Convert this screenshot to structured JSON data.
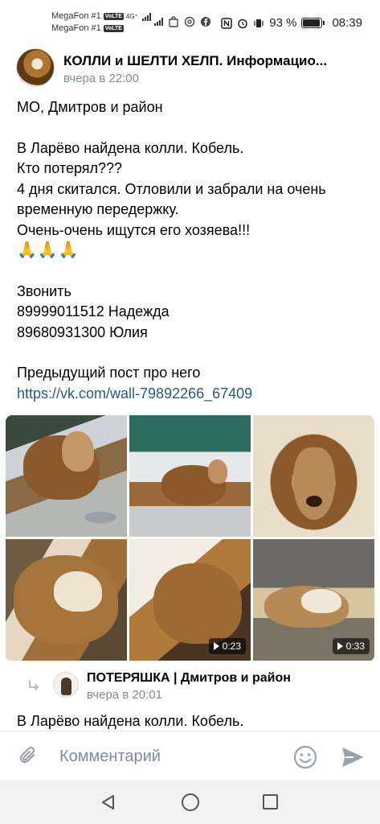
{
  "status_bar": {
    "carrier1": "MegaFon #1",
    "carrier2": "MegaFon #1",
    "volte": "VoLTE",
    "network_type": "4G⁺",
    "battery": "93 %",
    "battery_level": 0.93,
    "time": "08:39"
  },
  "post": {
    "group_name": "КОЛЛИ и ШЕЛТИ ХЕЛП. Информацио...",
    "time": "вчера в 22:00",
    "location": "МО, Дмитров и район",
    "lines": [
      "В Ларёво найдена колли. Кобель.",
      "Кто потерял???",
      "4 дня скитался. Отловили и забрали на очень временную передержку.",
      "Очень-очень ищутся его хозяева!!!"
    ],
    "emoji": "🙏🙏🙏",
    "call_label": "Звонить",
    "contact1": "89999011512 Надежда",
    "contact2": "89680931300 Юлия",
    "previous_label": "Предыдущий пост про него",
    "link": "https://vk.com/wall-79892266_67409"
  },
  "media": {
    "videos": [
      {
        "duration": "0:23"
      },
      {
        "duration": "0:33"
      }
    ]
  },
  "repost": {
    "icon": "repost-arrow-icon",
    "group_name": "ПОТЕРЯШКА | Дмитров и район",
    "time": "вчера в 20:01",
    "text": "В Ларёво найдена колли. Кобель."
  },
  "comment_bar": {
    "placeholder": "Комментарий"
  },
  "colors": {
    "link": "#2a5885",
    "secondary_text": "#818c99",
    "icon": "#99a2ad"
  }
}
